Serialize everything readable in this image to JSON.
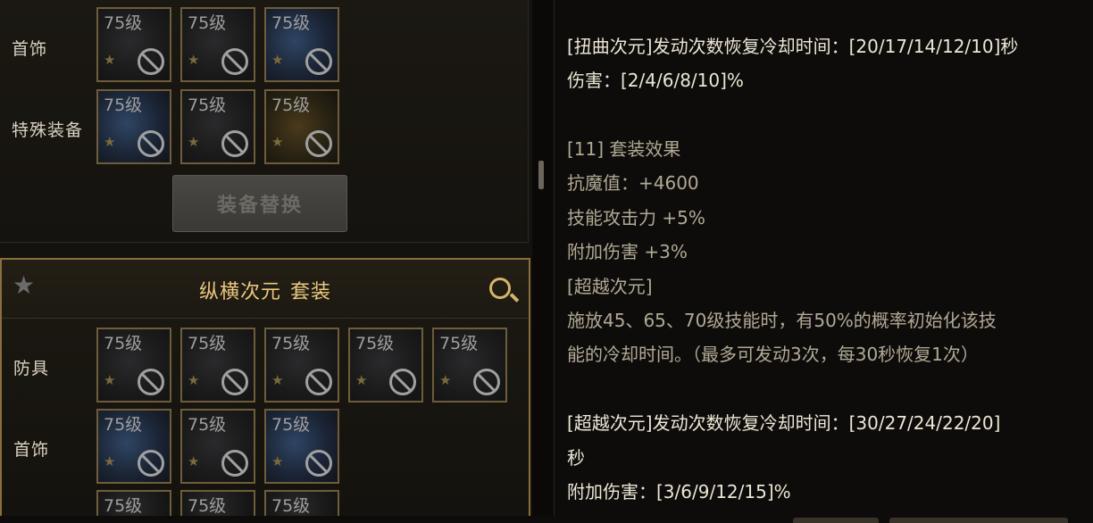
{
  "top_set": {
    "rows": [
      {
        "label": "首饰",
        "slots": [
          {
            "level": "75级",
            "tone": "dark"
          },
          {
            "level": "75级",
            "tone": "dark"
          },
          {
            "level": "75级",
            "tone": "blue"
          }
        ]
      },
      {
        "label": "特殊装备",
        "slots": [
          {
            "level": "75级",
            "tone": "blue"
          },
          {
            "level": "75级",
            "tone": "dark"
          },
          {
            "level": "75级",
            "tone": "gold"
          }
        ]
      }
    ],
    "swap_button": "装备替换"
  },
  "bottom_set": {
    "set_name": "纵横次元",
    "set_suffix": "套装",
    "rows": [
      {
        "label": "防具",
        "slots": [
          {
            "level": "75级"
          },
          {
            "level": "75级"
          },
          {
            "level": "75级"
          },
          {
            "level": "75级"
          },
          {
            "level": "75级"
          }
        ]
      },
      {
        "label": "首饰",
        "slots": [
          {
            "level": "75级"
          },
          {
            "level": "75级"
          },
          {
            "level": "75级"
          }
        ]
      }
    ],
    "partial_slot_level": "75级"
  },
  "description": {
    "lines": [
      "[扭曲次元]发动次数恢复冷却时间：[20/17/14/12/10]秒",
      "伤害：[2/4/6/8/10]%",
      "",
      "[11] 套装效果",
      "抗魔值：+4600",
      "技能攻击力 +5%",
      "附加伤害 +3%",
      "[超越次元]",
      "施放45、65、70级技能时，有50%的概率初始化该技",
      "能的冷却时间。（最多可发动3次，每30秒恢复1次）",
      "",
      "[超越次元]发动次数恢复冷却时间：[30/27/24/22/20]",
      "秒",
      "附加伤害：[3/6/9/12/15]%"
    ]
  },
  "colors": {
    "accent_gold": "#e9c77e",
    "panel_border": "#8a6e3e"
  },
  "icons": [
    "star-icon",
    "search-icon",
    "ban-icon"
  ]
}
